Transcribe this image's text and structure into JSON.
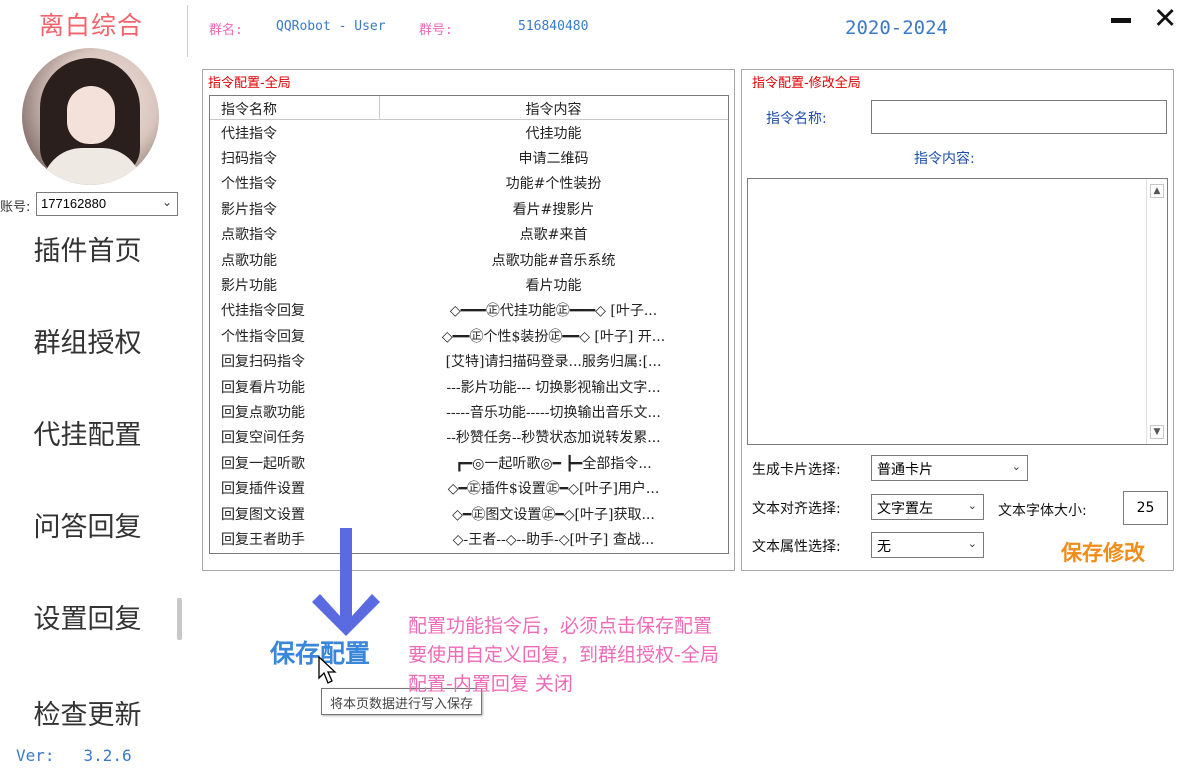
{
  "sidebar": {
    "app_title": "离白综合",
    "account_label": "账号:",
    "account_value": "177162880",
    "nav": [
      {
        "label": "插件首页"
      },
      {
        "label": "群组授权"
      },
      {
        "label": "代挂配置"
      },
      {
        "label": "问答回复"
      },
      {
        "label": "设置回复"
      },
      {
        "label": "检查更新"
      }
    ],
    "version_label": "Ver:",
    "version_value": "3.2.6"
  },
  "header": {
    "group_name_label": "群名:",
    "group_name": "QQRobot - User",
    "group_id_label": "群号:",
    "group_id": "516840480",
    "years": "2020-2024",
    "min_symbol": "–",
    "close_symbol": "✕"
  },
  "left_panel": {
    "title": "指令配置-全局",
    "columns": [
      "指令名称",
      "指令内容"
    ],
    "rows": [
      {
        "name": "代挂指令",
        "content": "代挂功能"
      },
      {
        "name": "扫码指令",
        "content": "申请二维码"
      },
      {
        "name": "个性指令",
        "content": "功能#个性装扮"
      },
      {
        "name": "影片指令",
        "content": "看片#搜影片"
      },
      {
        "name": "点歌指令",
        "content": "点歌#来首"
      },
      {
        "name": "点歌功能",
        "content": "点歌功能#音乐系统"
      },
      {
        "name": "影片功能",
        "content": "看片功能"
      },
      {
        "name": "代挂指令回复",
        "content": "◇━━━㊣代挂功能㊣━━━◇  [叶子..."
      },
      {
        "name": "个性指令回复",
        "content": "◇━━㊣个性$装扮㊣━━◇ [叶子] 开..."
      },
      {
        "name": "回复扫码指令",
        "content": "[艾特]请扫描码登录...服务归属:[..."
      },
      {
        "name": "回复看片功能",
        "content": "---影片功能---  切换影视输出文字..."
      },
      {
        "name": "回复点歌功能",
        "content": "-----音乐功能-----切换输出音乐文..."
      },
      {
        "name": "回复空间任务",
        "content": "--秒赞任务--秒赞状态加说转发累..."
      },
      {
        "name": "回复一起听歌",
        "content": "┏━◎一起听歌◎━ ┣━全部指令..."
      },
      {
        "name": "回复插件设置",
        "content": "◇━㊣插件$设置㊣━◇[叶子]用户..."
      },
      {
        "name": "回复图文设置",
        "content": "◇━㊣图文设置㊣━◇[叶子]获取..."
      },
      {
        "name": "回复王者助手",
        "content": "◇-王者--◇--助手-◇[叶子] 查战..."
      }
    ]
  },
  "right_panel": {
    "title": "指令配置-修改全局",
    "name_label": "指令名称:",
    "name_value": "",
    "content_label": "指令内容:",
    "content_value": "",
    "card_label": "生成卡片选择:",
    "card_value": "普通卡片",
    "align_label": "文本对齐选择:",
    "align_value": "文字置左",
    "font_size_label": "文本字体大小:",
    "font_size_value": "25",
    "attr_label": "文本属性选择:",
    "attr_value": "无",
    "save_label": "保存修改"
  },
  "bottom": {
    "save_config_label": "保存配置",
    "tooltip": "将本页数据进行写入保存",
    "hints": [
      "配置功能指令后，必须点击保存配置",
      "要使用自定义回复，到群组授权-全局",
      "配置-内置回复 关闭"
    ]
  },
  "colors": {
    "title_red": "#f2636b",
    "blue_text": "#3a7ac8",
    "group_title_red": "#e00000",
    "save_orange": "#f08c18",
    "hint_pink": "#f06ab8",
    "arrow": "#5a6ae0"
  }
}
